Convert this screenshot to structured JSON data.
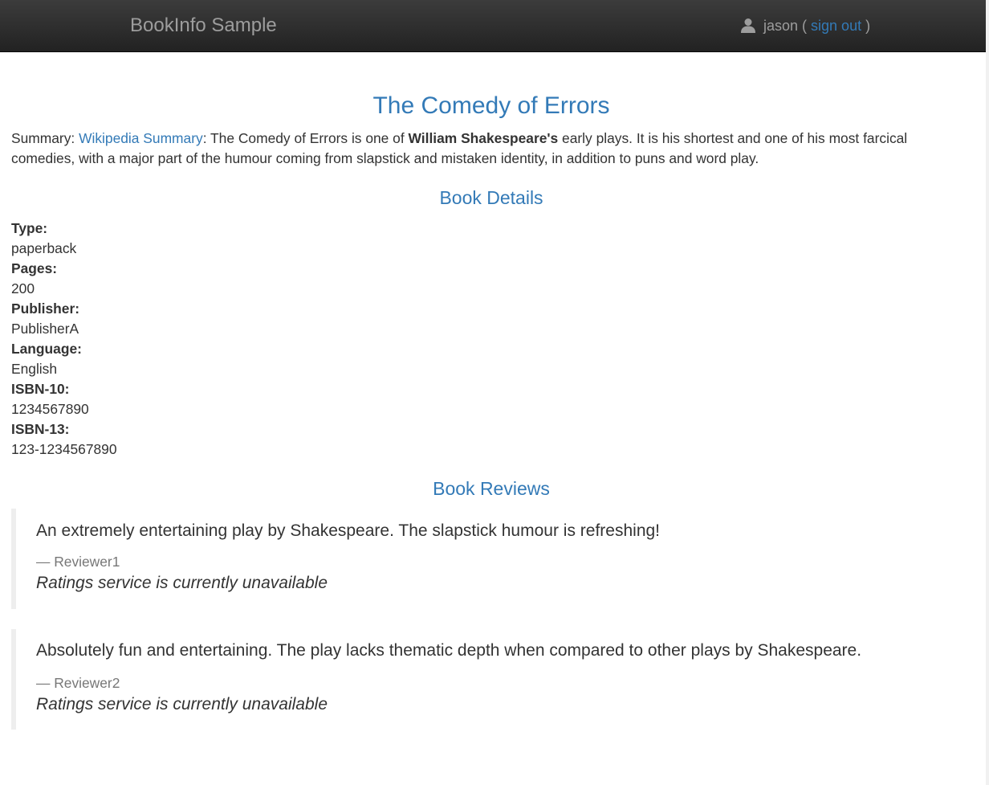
{
  "colors": {
    "navbar": "#222222",
    "link": "#337ab7",
    "muted": "#9d9d9d",
    "text": "#333333"
  },
  "navbar": {
    "brand": "BookInfo Sample",
    "user": {
      "icon": "user-icon",
      "name": "jason",
      "open_paren": "(",
      "signout_label": "sign out",
      "close_paren": ")"
    }
  },
  "book": {
    "title": "The Comedy of Errors",
    "summary": {
      "prefix": "Summary: ",
      "link_label": "Wikipedia Summary",
      "text_before_bold": ": The Comedy of Errors is one of ",
      "bold": "William Shakespeare's",
      "text_after_bold": " early plays. It is his shortest and one of his most farcical comedies, with a major part of the humour coming from slapstick and mistaken identity, in addition to puns and word play."
    }
  },
  "details": {
    "heading": "Book Details",
    "fields": [
      {
        "label": "Type:",
        "value": "paperback"
      },
      {
        "label": "Pages:",
        "value": "200"
      },
      {
        "label": "Publisher:",
        "value": "PublisherA"
      },
      {
        "label": "Language:",
        "value": "English"
      },
      {
        "label": "ISBN-10:",
        "value": "1234567890"
      },
      {
        "label": "ISBN-13:",
        "value": "123-1234567890"
      }
    ]
  },
  "reviews": {
    "heading": "Book Reviews",
    "items": [
      {
        "text": "An extremely entertaining play by Shakespeare. The slapstick humour is refreshing!",
        "reviewer": "— Reviewer1",
        "rating": "Ratings service is currently unavailable"
      },
      {
        "text": "Absolutely fun and entertaining. The play lacks thematic depth when compared to other plays by Shakespeare.",
        "reviewer": "— Reviewer2",
        "rating": "Ratings service is currently unavailable"
      }
    ]
  }
}
